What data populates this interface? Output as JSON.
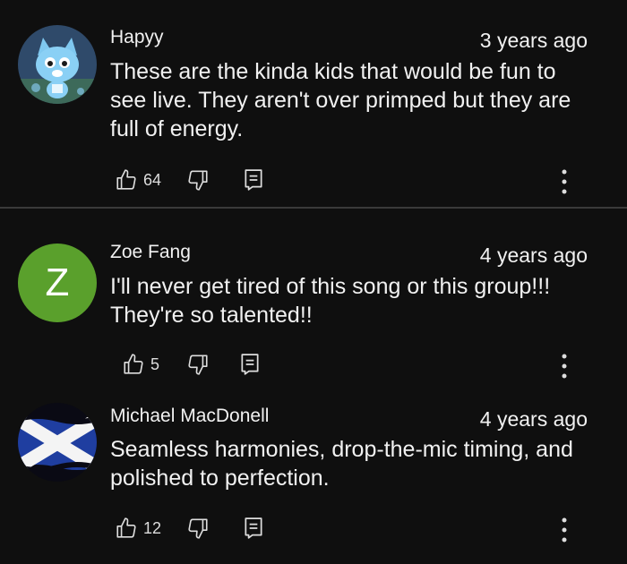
{
  "colors": {
    "background": "#0f0f0f",
    "text": "#f1f1f1",
    "letter_avatar_bg": "#5aa02c",
    "divider": "#3a3a3a"
  },
  "comments": [
    {
      "author": "Hapyy",
      "time": "3 years ago",
      "text_lines": [
        "These are the kinda kids that would be fun to",
        "see live. They aren't over primped but they are",
        "full of energy."
      ],
      "likes": "64",
      "avatar": "happy-cat-icon"
    },
    {
      "author": "Zoe Fang",
      "time": "4 years ago",
      "text_lines": [
        "I'll never get tired of this song or this group!!!",
        "They're so talented!!"
      ],
      "likes": "5",
      "avatar_letter": "Z"
    },
    {
      "author": "Michael MacDonell",
      "time": "4 years ago",
      "text_lines": [
        "Seamless harmonies, drop-the-mic timing, and",
        "polished to perfection."
      ],
      "likes": "12",
      "avatar": "scotland-flag-icon"
    }
  ],
  "icons": {
    "like": "thumbs-up-icon",
    "dislike": "thumbs-down-icon",
    "reply": "reply-icon",
    "menu": "more-vertical-icon"
  }
}
